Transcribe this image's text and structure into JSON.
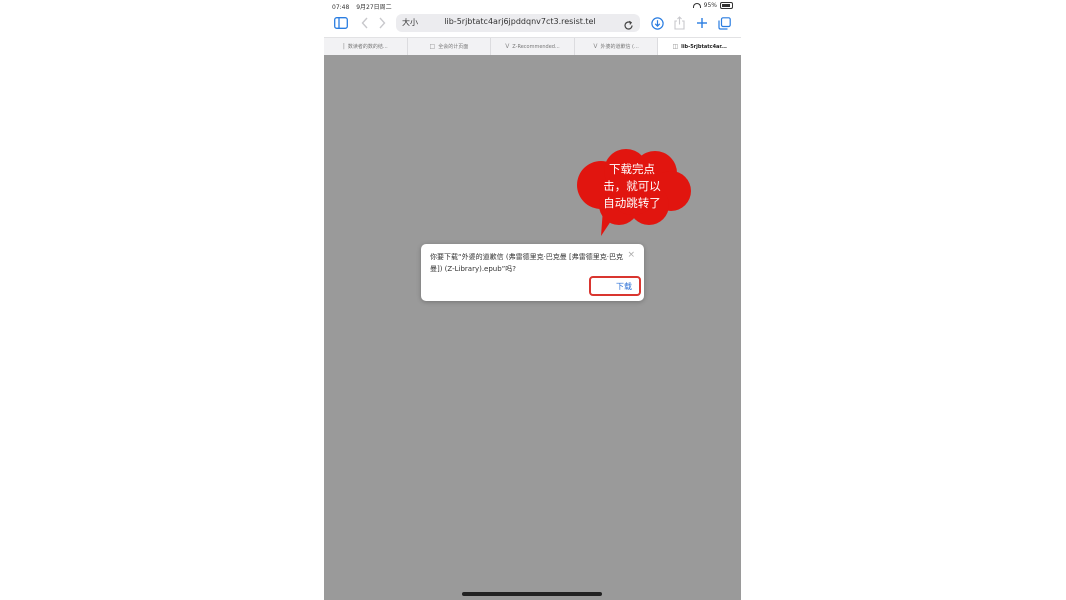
{
  "status_bar": {
    "time": "07:48",
    "date": "9月27日周二",
    "battery": "95%"
  },
  "toolbar": {
    "aa_label": "大小",
    "url": "lib-5rjbtatc4arj6jpddqnv7ct3.resist.tel"
  },
  "tabs": [
    {
      "label": "数读者的数的结...",
      "icon": "|"
    },
    {
      "label": "全会的计页面",
      "icon": "□"
    },
    {
      "label": "Z-Recommended...",
      "icon": "V"
    },
    {
      "label": "外婆的道歉信 (...",
      "icon": "V"
    },
    {
      "label": "lib-5rjbtatc4ar...",
      "icon": "◫",
      "active": true
    }
  ],
  "callout": {
    "lines": [
      "下载完点",
      "击，就可以",
      "自动跳转了"
    ]
  },
  "dialog": {
    "message": "你要下载“外婆的道歉信 (弗雷德里克·巴克曼 [弗雷德里克·巴克曼]) (Z-Library).epub”吗?",
    "button": "下载",
    "close": "×"
  }
}
